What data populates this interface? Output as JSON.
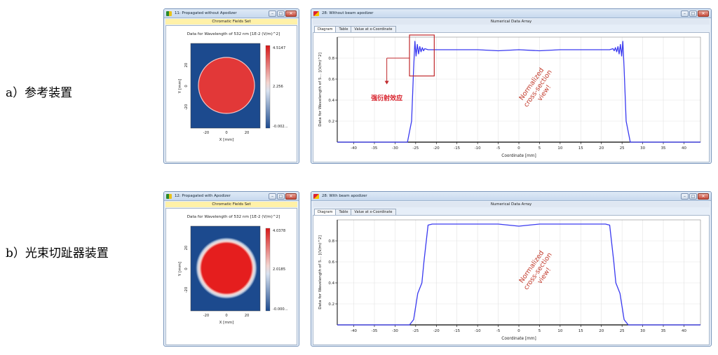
{
  "rows": [
    {
      "label": "a）参考装置",
      "field_window": {
        "title": "11: Propagated without Apodizer",
        "subtitle": "Chromatic Fields Set",
        "plot_title": "Data for Wavelength of 532 nm  [1E-2 (V/m)^2]",
        "xlabel": "X [mm]",
        "ylabel": "Y [mm]",
        "x_ticks": [
          "-20",
          "0",
          "20"
        ],
        "y_ticks": [
          "20",
          "0",
          "-20"
        ],
        "colorbar_labels": [
          "4.5147",
          "2.256",
          "-0.002..."
        ]
      },
      "data_window": {
        "title": "28: Without beam apodizer",
        "subtitle": "Numerical Data Array",
        "tabs": [
          "Diagram",
          "Table",
          "Value at x-Coordinate"
        ],
        "active_tab": "Diagram",
        "annotation": "强衍射效应",
        "watermark_lines": [
          "Normalized",
          "cross-section",
          "view!"
        ],
        "chart_data": {
          "type": "line",
          "xlabel": "Coordinate [mm]",
          "ylabel": "Data for Wavelength of 5... [(V/m)^2]",
          "xlim": [
            -44,
            44
          ],
          "ylim": [
            0,
            1.0
          ],
          "x_ticks": [
            -40,
            -35,
            -30,
            -25,
            -20,
            -15,
            -10,
            -5,
            0,
            5,
            10,
            15,
            20,
            25,
            30,
            35,
            40
          ],
          "y_ticks": [
            0.2,
            0.4,
            0.6,
            0.8
          ],
          "grid": true,
          "series": [
            {
              "color": "#3a3af0",
              "x": [
                -44,
                -27,
                -26,
                -25.5,
                -25.2,
                -24.9,
                -24.6,
                -24.3,
                -24.0,
                -23.7,
                -23.4,
                -23.1,
                -22.8,
                -22,
                -20,
                -15,
                -10,
                -5,
                0,
                5,
                10,
                15,
                20,
                22,
                22.8,
                23.1,
                23.4,
                23.7,
                24.0,
                24.3,
                24.6,
                24.9,
                25.2,
                25.5,
                26,
                27,
                44
              ],
              "y": [
                0,
                0,
                0.2,
                0.7,
                0.96,
                0.82,
                0.93,
                0.84,
                0.91,
                0.86,
                0.9,
                0.87,
                0.89,
                0.88,
                0.88,
                0.88,
                0.88,
                0.87,
                0.88,
                0.87,
                0.88,
                0.88,
                0.88,
                0.88,
                0.89,
                0.87,
                0.9,
                0.86,
                0.91,
                0.84,
                0.93,
                0.82,
                0.96,
                0.7,
                0.2,
                0,
                0
              ]
            }
          ]
        }
      }
    },
    {
      "label": "b）光束切趾器装置",
      "field_window": {
        "title": "12: Propagated with Apodizer",
        "subtitle": "Chromatic Fields Set",
        "plot_title": "Data for Wavelength of 532 nm  [1E-2 (V/m)^2]",
        "xlabel": "X [mm]",
        "ylabel": "Y [mm]",
        "x_ticks": [
          "-20",
          "0",
          "20"
        ],
        "y_ticks": [
          "20",
          "0",
          "-20"
        ],
        "colorbar_labels": [
          "4.0378",
          "2.0185",
          "-0.000..."
        ]
      },
      "data_window": {
        "title": "28: With beam apodizer",
        "subtitle": "Numerical Data Array",
        "tabs": [
          "Diagram",
          "Table",
          "Value at x-Coordinate"
        ],
        "active_tab": "Diagram",
        "watermark_lines": [
          "Normalized",
          "cross-section",
          "view!"
        ],
        "chart_data": {
          "type": "line",
          "xlabel": "Coordinate [mm]",
          "ylabel": "Data for Wavelength of 5... [(V/m)^2]",
          "xlim": [
            -44,
            44
          ],
          "ylim": [
            0,
            1.0
          ],
          "x_ticks": [
            -40,
            -35,
            -30,
            -25,
            -20,
            -15,
            -10,
            -5,
            0,
            5,
            10,
            15,
            20,
            25,
            30,
            35,
            40
          ],
          "y_ticks": [
            0.2,
            0.4,
            0.6,
            0.8
          ],
          "grid": true,
          "series": [
            {
              "color": "#3a3af0",
              "x": [
                -44,
                -26.5,
                -25.5,
                -24.5,
                -23.5,
                -23.0,
                -22.0,
                -21.0,
                -20,
                -15,
                -10,
                -5,
                0,
                5,
                10,
                15,
                20,
                21.0,
                22.0,
                23.0,
                23.5,
                24.5,
                25.5,
                26.5,
                44
              ],
              "y": [
                0,
                0,
                0.05,
                0.3,
                0.4,
                0.6,
                0.95,
                0.96,
                0.96,
                0.96,
                0.96,
                0.96,
                0.94,
                0.96,
                0.96,
                0.96,
                0.96,
                0.96,
                0.95,
                0.6,
                0.4,
                0.3,
                0.05,
                0,
                0
              ]
            }
          ]
        }
      }
    }
  ]
}
